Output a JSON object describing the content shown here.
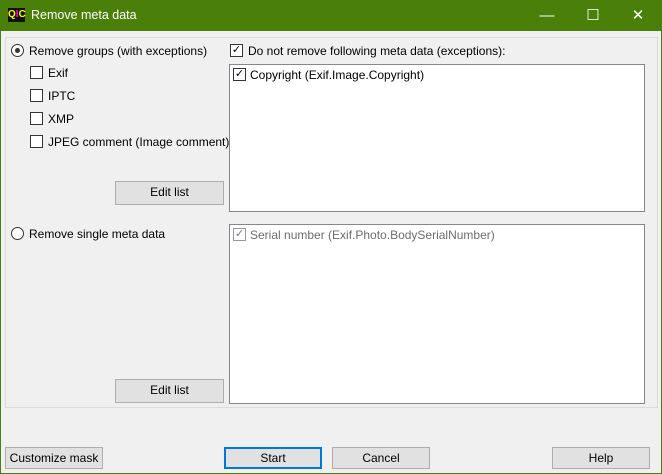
{
  "window": {
    "title": "Remove meta data",
    "logo": "QIC",
    "minimize": "—",
    "maximize": "☐",
    "close": "✕"
  },
  "groups": {
    "radio_label": "Remove groups (with exceptions)",
    "selected": true,
    "items": [
      {
        "label": "Exif",
        "checked": false
      },
      {
        "label": "IPTC",
        "checked": false
      },
      {
        "label": "XMP",
        "checked": false
      },
      {
        "label": "JPEG comment (Image comment)",
        "checked": false
      }
    ],
    "edit_list": "Edit list",
    "exceptions_label": "Do not remove following meta data (exceptions):",
    "exceptions_checked": true,
    "exceptions": [
      {
        "label": "Copyright (Exif.Image.Copyright)",
        "checked": true
      }
    ]
  },
  "single": {
    "radio_label": "Remove single meta data",
    "selected": false,
    "edit_list": "Edit list",
    "items": [
      {
        "label": "Serial number (Exif.Photo.BodySerialNumber)",
        "checked": true
      }
    ]
  },
  "buttons": {
    "customize": "Customize mask",
    "start": "Start",
    "cancel": "Cancel",
    "help": "Help"
  }
}
